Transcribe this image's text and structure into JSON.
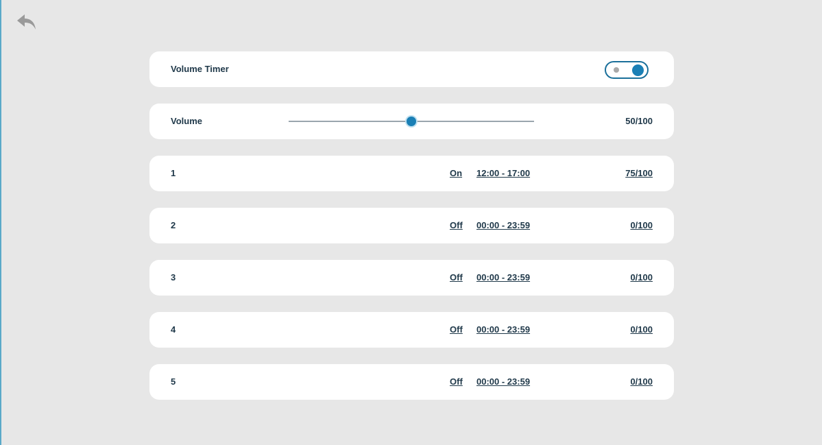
{
  "colors": {
    "background": "#e7e7e7",
    "card": "#ffffff",
    "accent": "#1a7fb5",
    "text": "#20394a"
  },
  "header": {
    "back_icon": "back-arrow-icon"
  },
  "volume_timer": {
    "label": "Volume Timer",
    "enabled": true
  },
  "volume": {
    "label": "Volume",
    "value": 50,
    "max": 100,
    "display": "50/100"
  },
  "timers": [
    {
      "index": "1",
      "state": "On",
      "range": "12:00 - 17:00",
      "volume": "75/100"
    },
    {
      "index": "2",
      "state": "Off",
      "range": "00:00 - 23:59",
      "volume": "0/100"
    },
    {
      "index": "3",
      "state": "Off",
      "range": "00:00 - 23:59",
      "volume": "0/100"
    },
    {
      "index": "4",
      "state": "Off",
      "range": "00:00 - 23:59",
      "volume": "0/100"
    },
    {
      "index": "5",
      "state": "Off",
      "range": "00:00 - 23:59",
      "volume": "0/100"
    }
  ]
}
